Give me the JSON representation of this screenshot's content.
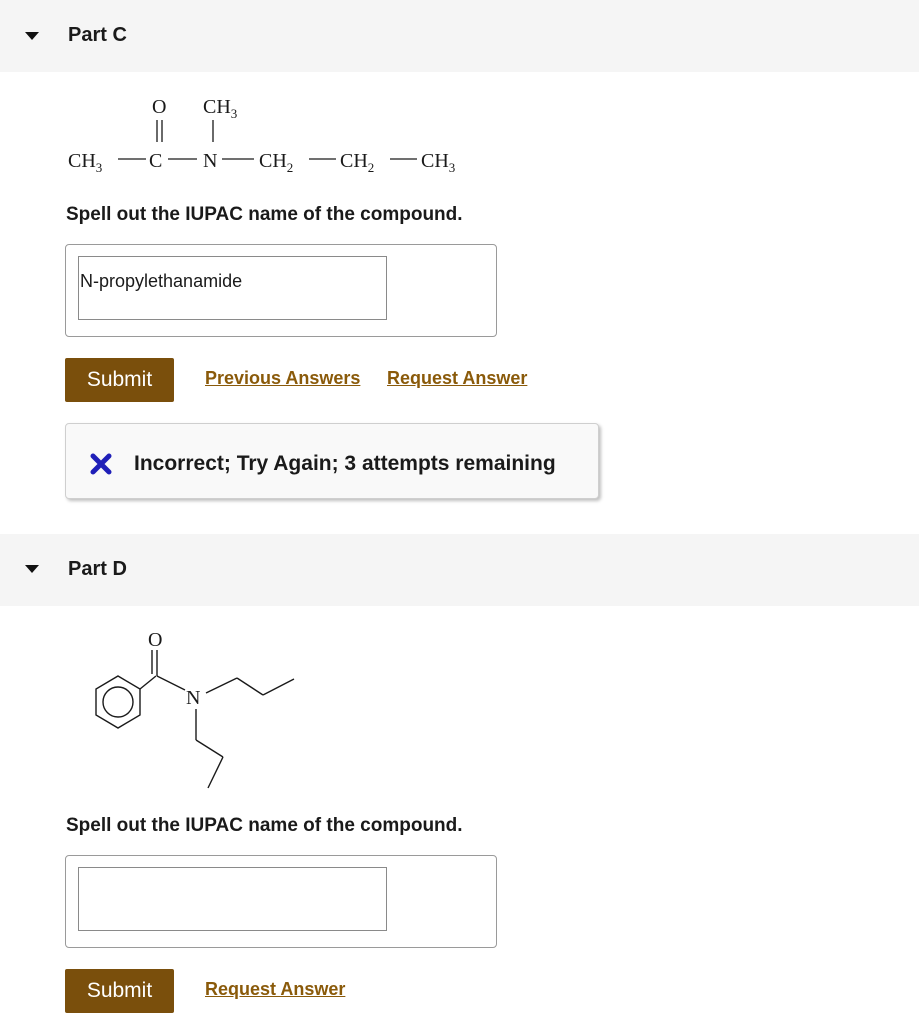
{
  "parts": [
    {
      "title": "Part C",
      "structure": {
        "top_row": {
          "oxygen": "O",
          "methyl": "CH",
          "methyl_sub": "3"
        },
        "chain": {
          "left_methyl": "CH",
          "left_methyl_sub": "3",
          "carbonyl_carbon": "C",
          "nitrogen": "N",
          "ch2_a": "CH",
          "ch2_a_sub": "2",
          "ch2_b": "CH",
          "ch2_b_sub": "2",
          "right_methyl": "CH",
          "right_methyl_sub": "3"
        }
      },
      "prompt": "Spell out the IUPAC name of the compound.",
      "answer_value": "N-propylethanamide",
      "submit_label": "Submit",
      "links": [
        "Previous Answers",
        "Request Answer"
      ],
      "feedback": {
        "icon": "x-mark-icon",
        "text": "Incorrect; Try Again; 3 attempts remaining"
      }
    },
    {
      "title": "Part D",
      "structure": {
        "oxygen": "O",
        "nitrogen": "N"
      },
      "prompt": "Spell out the IUPAC name of the compound.",
      "answer_value": "",
      "submit_label": "Submit",
      "links": [
        "Request Answer"
      ]
    }
  ],
  "colors": {
    "header_bg": "#f5f5f5",
    "submit_bg": "#7a4f0c",
    "link": "#8a5a0a",
    "error_icon": "#1f1fb8"
  }
}
